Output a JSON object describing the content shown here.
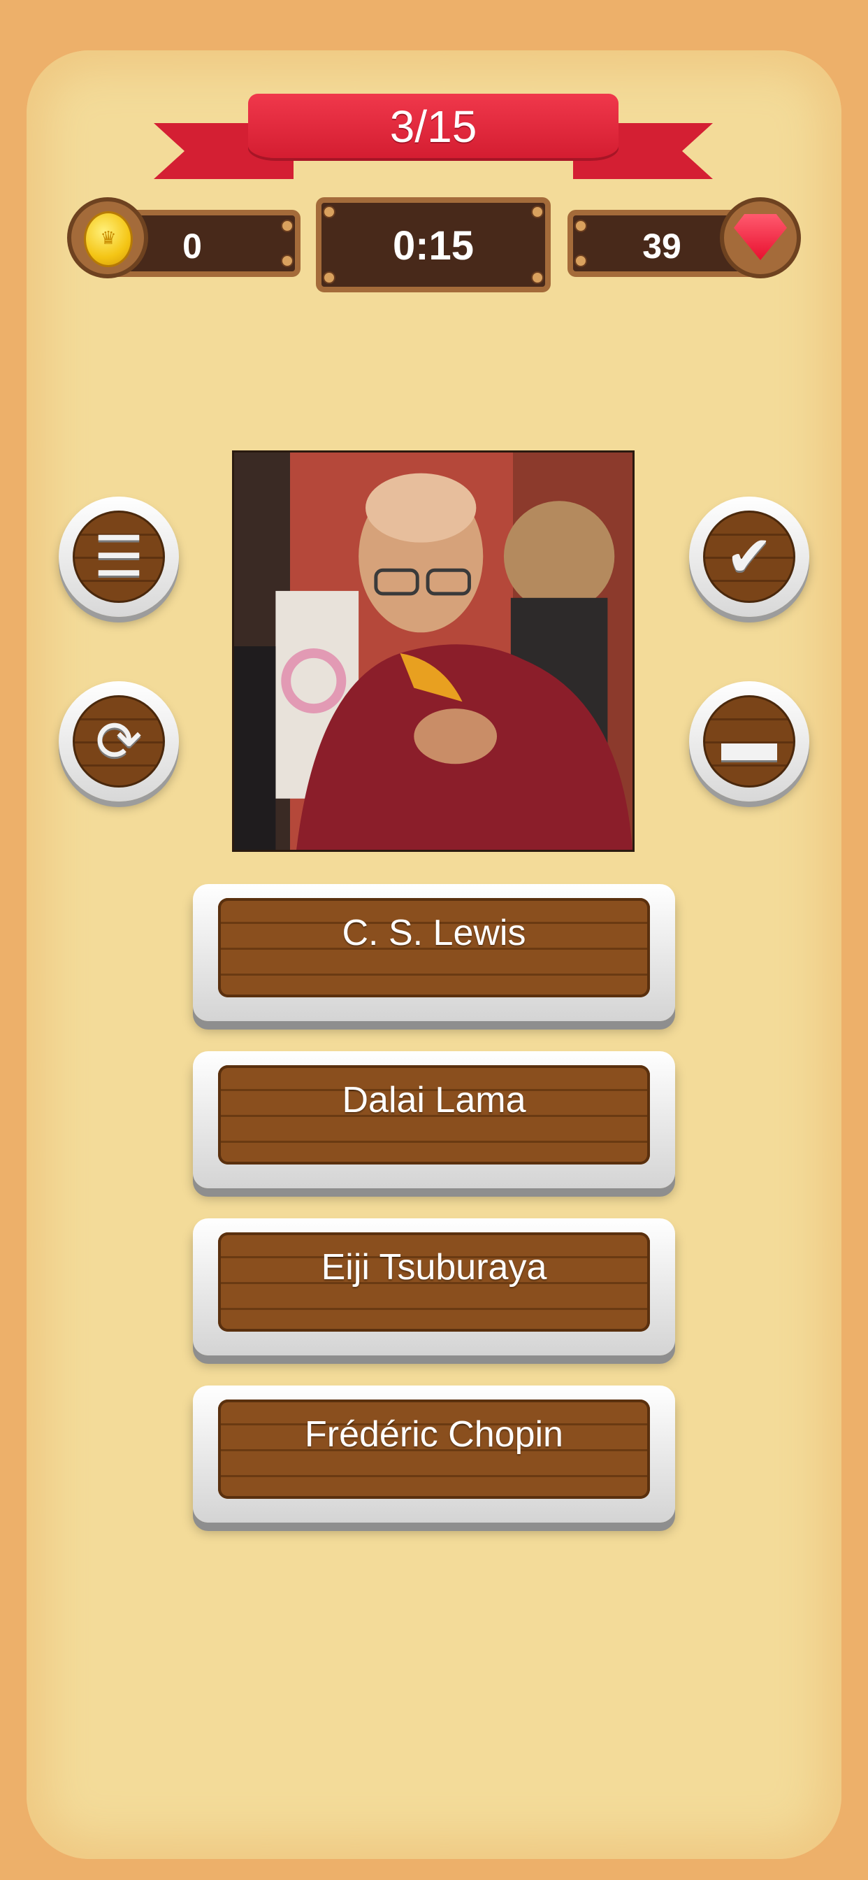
{
  "header": {
    "progress": "3/15"
  },
  "stats": {
    "coins": "0",
    "timer": "0:15",
    "gems": "39"
  },
  "tools": {
    "list_icon": "list-icon",
    "refresh_icon": "refresh-icon",
    "check_icon": "checkmark-icon",
    "minus_icon": "minus-icon",
    "coin_icon": "coin-icon",
    "gem_icon": "gem-icon"
  },
  "question": {
    "image": "portrait-photo"
  },
  "answers": [
    {
      "label": "C. S. Lewis"
    },
    {
      "label": "Dalai Lama"
    },
    {
      "label": "Eiji Tsuburaya"
    },
    {
      "label": "Frédéric Chopin"
    }
  ],
  "colors": {
    "background": "#EDB06A",
    "panel": "#F3DB99",
    "ribbon": "#E42A3E",
    "wood_dark": "#48291A",
    "wood_frame": "#A46B3A"
  }
}
